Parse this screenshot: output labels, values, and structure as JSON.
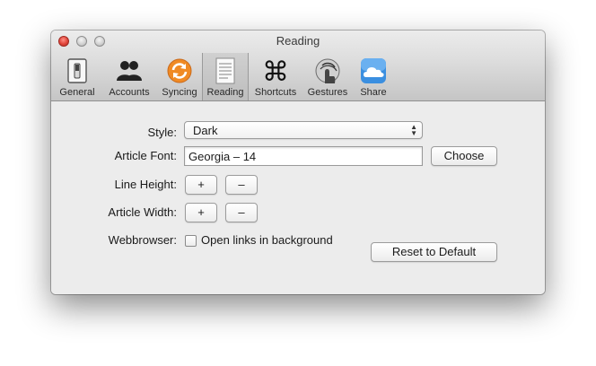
{
  "window": {
    "title": "Reading"
  },
  "toolbar": {
    "items": [
      {
        "label": "General",
        "icon": "switch-icon"
      },
      {
        "label": "Accounts",
        "icon": "people-icon"
      },
      {
        "label": "Syncing",
        "icon": "sync-icon"
      },
      {
        "label": "Reading",
        "icon": "document-icon",
        "selected": true
      },
      {
        "label": "Shortcuts",
        "icon": "command-key-icon"
      },
      {
        "label": "Gestures",
        "icon": "hand-gesture-icon"
      },
      {
        "label": "Share",
        "icon": "cloud-icon"
      }
    ]
  },
  "form": {
    "style_label": "Style:",
    "style_value": "Dark",
    "font_label": "Article Font:",
    "font_value": "Georgia – 14",
    "choose_button": "Choose",
    "line_height_label": "Line Height:",
    "article_width_label": "Article Width:",
    "plus": "+",
    "minus": "–",
    "webbrowser_label": "Webbrowser:",
    "open_links_label": "Open links in background",
    "open_links_checked": false,
    "reset_button": "Reset to Default"
  },
  "colors": {
    "accent_sync": "#f08a24",
    "cloud_blue": "#3b8fe0",
    "close_red": "#e0443a"
  }
}
